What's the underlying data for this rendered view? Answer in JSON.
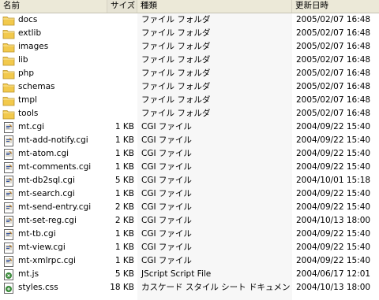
{
  "columns": {
    "name": "名前",
    "size": "サイズ",
    "type": "種類",
    "modified": "更新日時"
  },
  "files": [
    {
      "name": "docs",
      "size": "",
      "type": "ファイル フォルダ",
      "modified": "2005/02/07 16:48",
      "icon": "folder-icon"
    },
    {
      "name": "extlib",
      "size": "",
      "type": "ファイル フォルダ",
      "modified": "2005/02/07 16:48",
      "icon": "folder-icon"
    },
    {
      "name": "images",
      "size": "",
      "type": "ファイル フォルダ",
      "modified": "2005/02/07 16:48",
      "icon": "folder-icon"
    },
    {
      "name": "lib",
      "size": "",
      "type": "ファイル フォルダ",
      "modified": "2005/02/07 16:48",
      "icon": "folder-icon"
    },
    {
      "name": "php",
      "size": "",
      "type": "ファイル フォルダ",
      "modified": "2005/02/07 16:48",
      "icon": "folder-icon"
    },
    {
      "name": "schemas",
      "size": "",
      "type": "ファイル フォルダ",
      "modified": "2005/02/07 16:48",
      "icon": "folder-icon"
    },
    {
      "name": "tmpl",
      "size": "",
      "type": "ファイル フォルダ",
      "modified": "2005/02/07 16:48",
      "icon": "folder-icon"
    },
    {
      "name": "tools",
      "size": "",
      "type": "ファイル フォルダ",
      "modified": "2005/02/07 16:48",
      "icon": "folder-icon"
    },
    {
      "name": "mt.cgi",
      "size": "1 KB",
      "type": "CGI ファイル",
      "modified": "2004/09/22 15:40",
      "icon": "cgi-file-icon"
    },
    {
      "name": "mt-add-notify.cgi",
      "size": "1 KB",
      "type": "CGI ファイル",
      "modified": "2004/09/22 15:40",
      "icon": "cgi-file-icon"
    },
    {
      "name": "mt-atom.cgi",
      "size": "1 KB",
      "type": "CGI ファイル",
      "modified": "2004/09/22 15:40",
      "icon": "cgi-file-icon"
    },
    {
      "name": "mt-comments.cgi",
      "size": "1 KB",
      "type": "CGI ファイル",
      "modified": "2004/09/22 15:40",
      "icon": "cgi-file-icon"
    },
    {
      "name": "mt-db2sql.cgi",
      "size": "5 KB",
      "type": "CGI ファイル",
      "modified": "2004/10/01 15:18",
      "icon": "cgi-file-icon"
    },
    {
      "name": "mt-search.cgi",
      "size": "1 KB",
      "type": "CGI ファイル",
      "modified": "2004/09/22 15:40",
      "icon": "cgi-file-icon"
    },
    {
      "name": "mt-send-entry.cgi",
      "size": "2 KB",
      "type": "CGI ファイル",
      "modified": "2004/09/22 15:40",
      "icon": "cgi-file-icon"
    },
    {
      "name": "mt-set-reg.cgi",
      "size": "2 KB",
      "type": "CGI ファイル",
      "modified": "2004/10/13 18:00",
      "icon": "cgi-file-icon"
    },
    {
      "name": "mt-tb.cgi",
      "size": "1 KB",
      "type": "CGI ファイル",
      "modified": "2004/09/22 15:40",
      "icon": "cgi-file-icon"
    },
    {
      "name": "mt-view.cgi",
      "size": "1 KB",
      "type": "CGI ファイル",
      "modified": "2004/09/22 15:40",
      "icon": "cgi-file-icon"
    },
    {
      "name": "mt-xmlrpc.cgi",
      "size": "1 KB",
      "type": "CGI ファイル",
      "modified": "2004/09/22 15:40",
      "icon": "cgi-file-icon"
    },
    {
      "name": "mt.js",
      "size": "5 KB",
      "type": "JScript Script File",
      "modified": "2004/06/17 12:01",
      "icon": "js-file-icon"
    },
    {
      "name": "styles.css",
      "size": "18 KB",
      "type": "カスケード スタイル シート ドキュメント",
      "modified": "2004/10/13 18:00",
      "icon": "css-file-icon"
    }
  ],
  "colors": {
    "header_bg": "#ece9d8",
    "type_column_bg": "#f7f7f7",
    "folder": "#f2c94c"
  }
}
